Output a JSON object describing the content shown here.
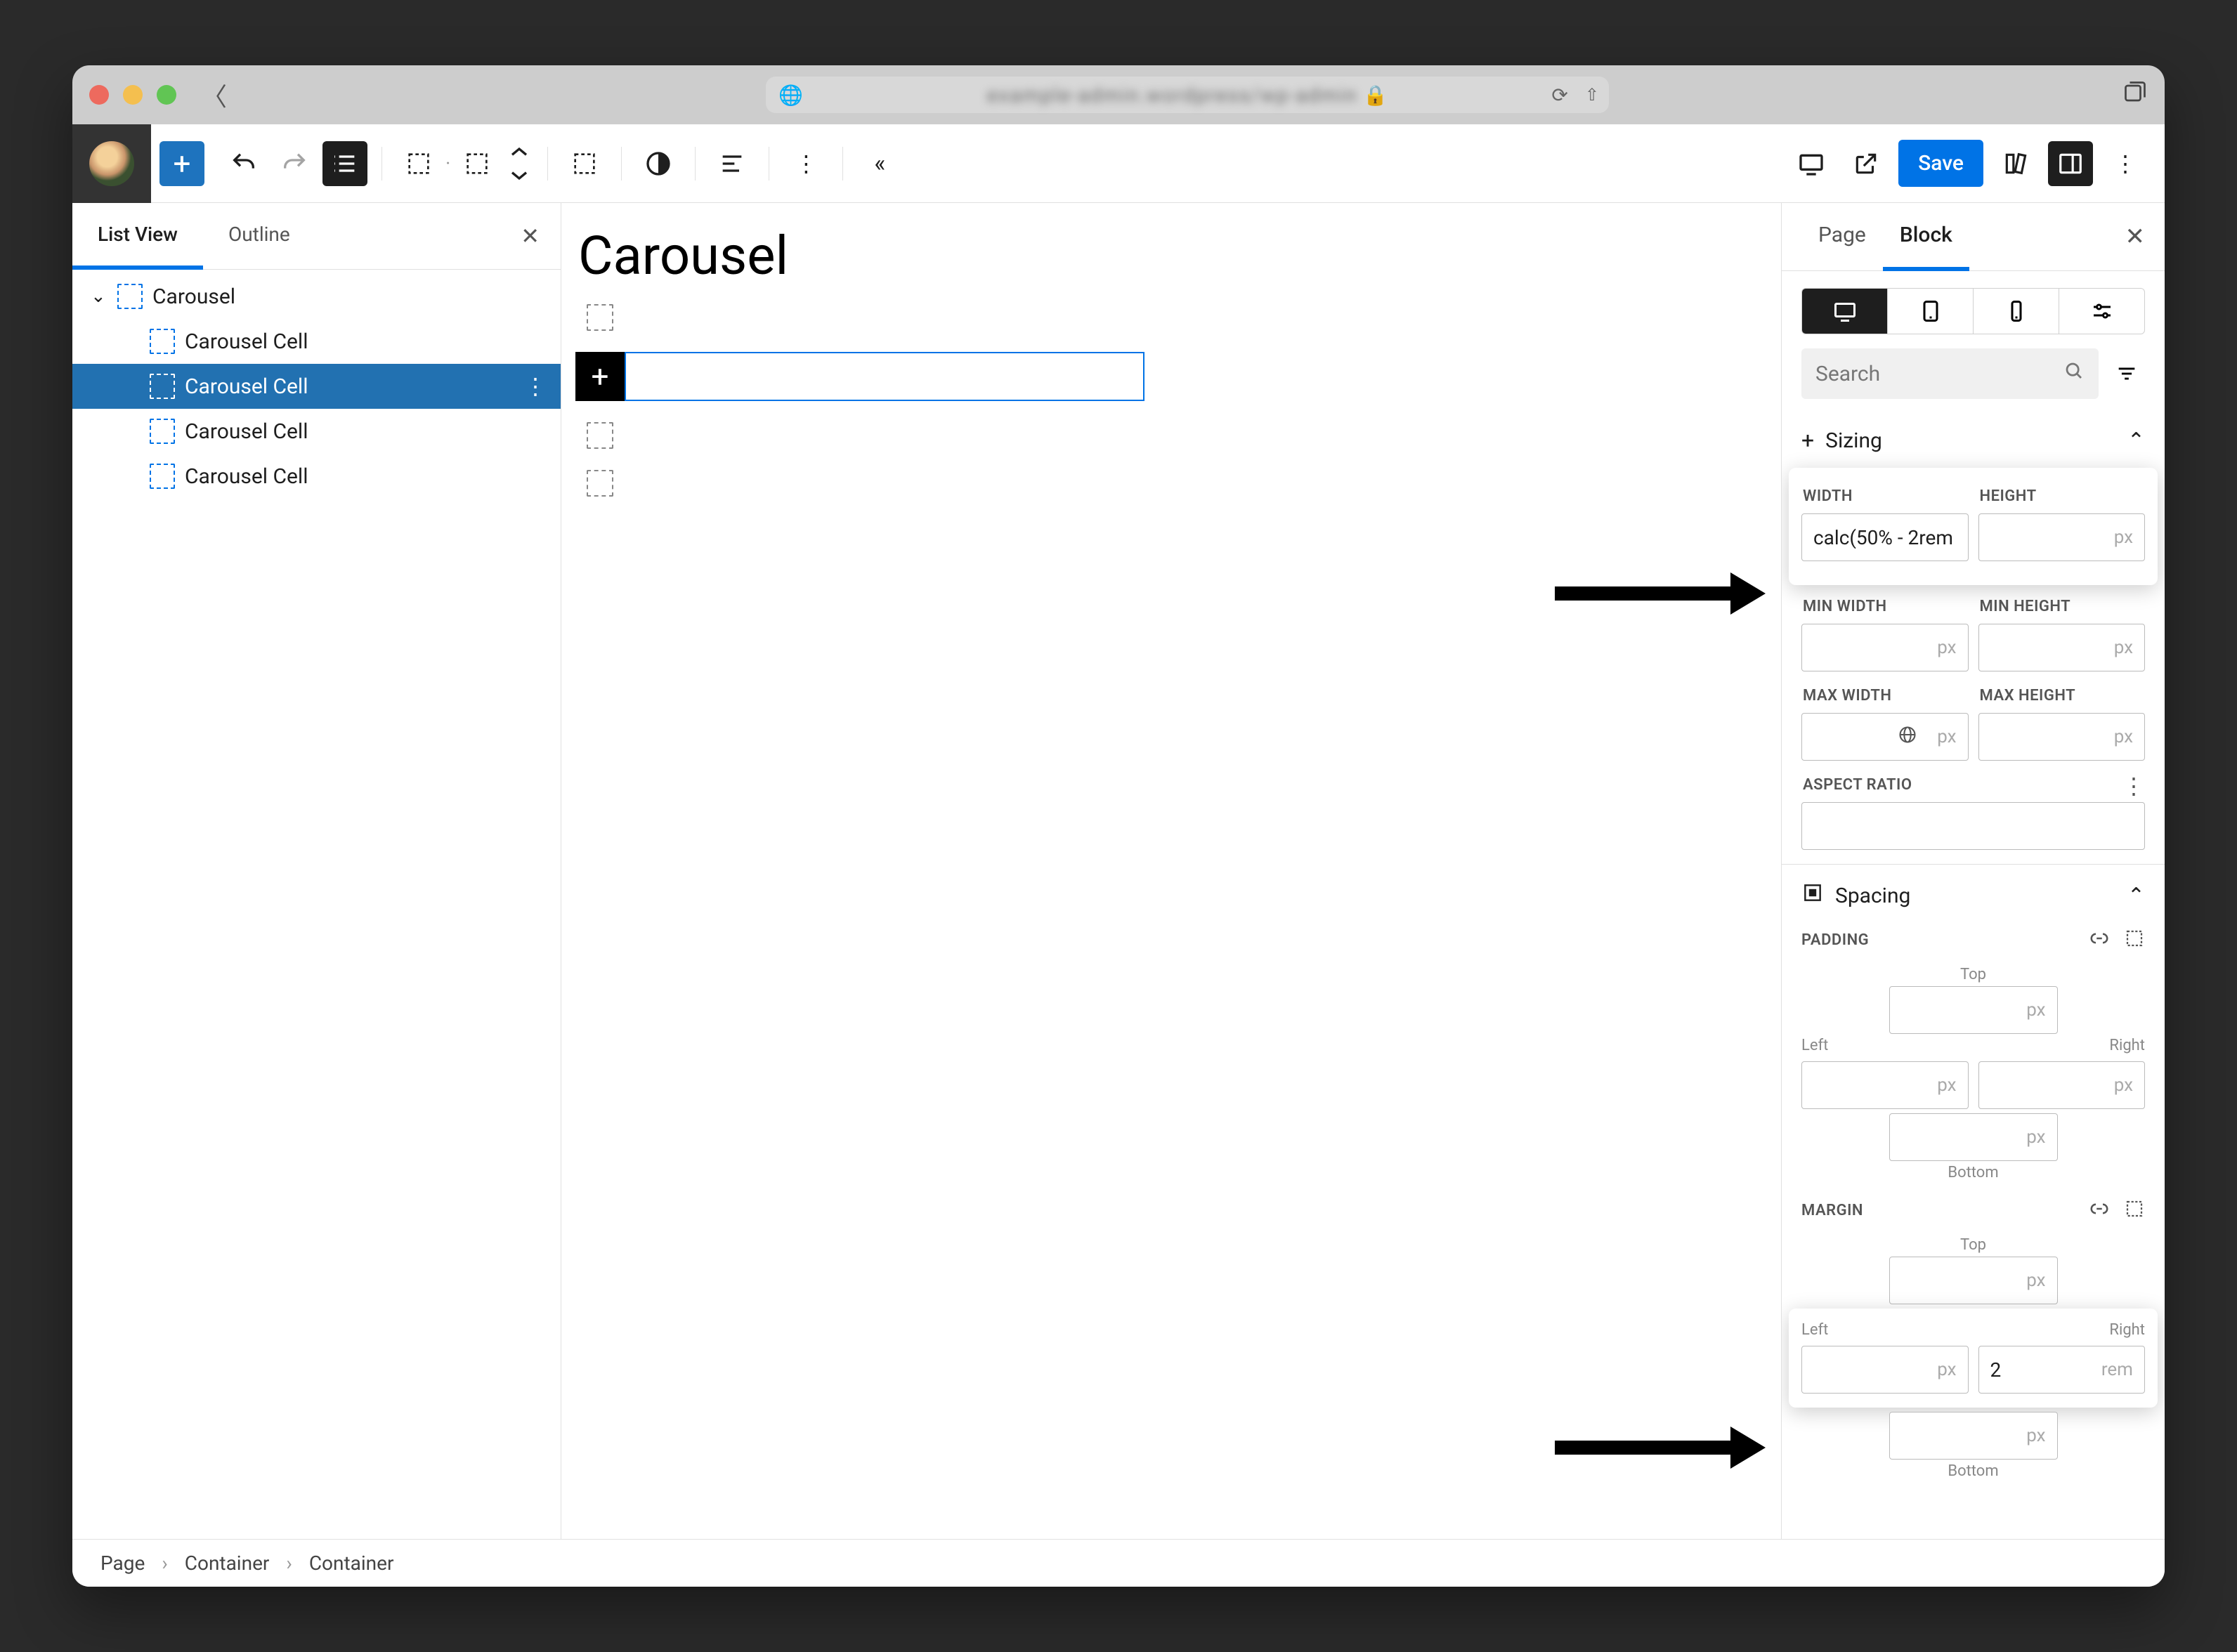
{
  "browser": {
    "address_placeholder": "example-admin.wordpress/wp-admin"
  },
  "toolbar": {
    "save_label": "Save"
  },
  "left_panel": {
    "tabs": {
      "list_view": "List View",
      "outline": "Outline"
    },
    "tree": {
      "root": "Carousel",
      "items": [
        "Carousel Cell",
        "Carousel Cell",
        "Carousel Cell",
        "Carousel Cell"
      ],
      "selected_index": 1
    }
  },
  "canvas": {
    "heading": "Carousel"
  },
  "right_panel": {
    "tabs": {
      "page": "Page",
      "block": "Block"
    },
    "search_placeholder": "Search",
    "sizing": {
      "title": "Sizing",
      "width_label": "Width",
      "width_value": "calc(50% - 2rem",
      "height_label": "Height",
      "height_unit": "px",
      "min_width_label": "Min Width",
      "min_width_unit": "px",
      "min_height_label": "Min Height",
      "min_height_unit": "px",
      "max_width_label": "Max Width",
      "max_width_unit": "px",
      "max_height_label": "Max Height",
      "max_height_unit": "px",
      "aspect_ratio_label": "Aspect Ratio"
    },
    "spacing": {
      "title": "Spacing",
      "padding_label": "Padding",
      "margin_label": "Margin",
      "sides": {
        "top": "Top",
        "bottom": "Bottom",
        "left": "Left",
        "right": "Right"
      },
      "unit_px": "px",
      "margin_right_value": "2",
      "margin_right_unit": "rem"
    }
  },
  "breadcrumb": {
    "p1": "Page",
    "p2": "Container",
    "p3": "Container"
  }
}
